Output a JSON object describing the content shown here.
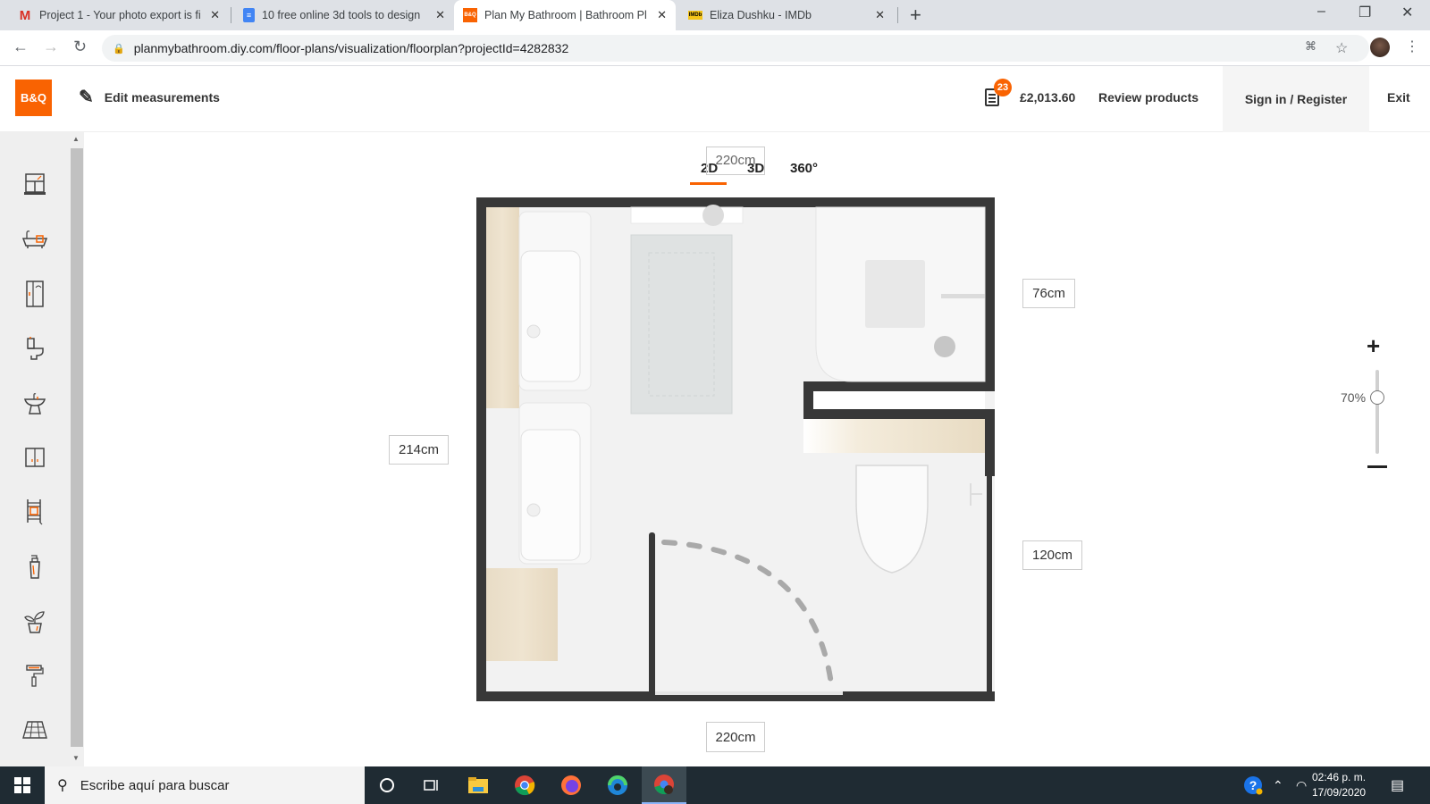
{
  "browser": {
    "tabs": [
      {
        "favicon": "gmail-icon",
        "title": "Project 1 - Your photo export is fi",
        "active": false
      },
      {
        "favicon": "google-docs-icon",
        "title": "10 free online 3d tools to design",
        "active": false
      },
      {
        "favicon": "bq-icon",
        "title": "Plan My Bathroom | Bathroom Pl",
        "active": true
      },
      {
        "favicon": "imdb-icon",
        "title": "Eliza Dushku - IMDb",
        "active": false
      }
    ],
    "url": "planmybathroom.diy.com/floor-plans/visualization/floorplan?projectId=4282832",
    "new_tab": "+",
    "window_controls": [
      "–",
      "❐",
      "✕"
    ]
  },
  "header": {
    "logo": "B&Q",
    "edit_measurements": "Edit measurements",
    "cart_count": "23",
    "price": "£2,013.60",
    "review_products": "Review products",
    "sign_in": "Sign in / Register",
    "exit": "Exit",
    "accent": "#f96302"
  },
  "sidebar": {
    "items": [
      {
        "name": "windows-doors",
        "icon": "window-icon"
      },
      {
        "name": "baths",
        "icon": "bath-icon"
      },
      {
        "name": "showers",
        "icon": "shower-icon"
      },
      {
        "name": "toilets",
        "icon": "toilet-icon"
      },
      {
        "name": "basins",
        "icon": "basin-icon"
      },
      {
        "name": "storage",
        "icon": "cabinet-icon"
      },
      {
        "name": "radiators",
        "icon": "towel-radiator-icon"
      },
      {
        "name": "accessories",
        "icon": "soap-dispenser-icon"
      },
      {
        "name": "decor",
        "icon": "plant-icon"
      },
      {
        "name": "paint",
        "icon": "paint-roller-icon"
      },
      {
        "name": "tiles",
        "icon": "tiles-icon"
      }
    ]
  },
  "view": {
    "tabs": [
      {
        "label": "2D",
        "active": true
      },
      {
        "label": "3D",
        "active": false
      },
      {
        "label": "360°",
        "active": false
      }
    ]
  },
  "dimensions": {
    "top": "220cm",
    "left": "214cm",
    "right_upper": "76cm",
    "right_lower": "120cm",
    "bottom": "220cm"
  },
  "zoom": {
    "plus": "+",
    "level_label": "70%",
    "level": 0.7
  },
  "taskbar": {
    "search_placeholder": "Escribe aquí para buscar",
    "time": "02:46 p. m.",
    "date": "17/09/2020",
    "apps": [
      "cortana-icon",
      "task-view-icon",
      "file-explorer-icon",
      "chrome-icon",
      "firefox-icon",
      "edge-icon",
      "chrome-profile-icon"
    ]
  }
}
